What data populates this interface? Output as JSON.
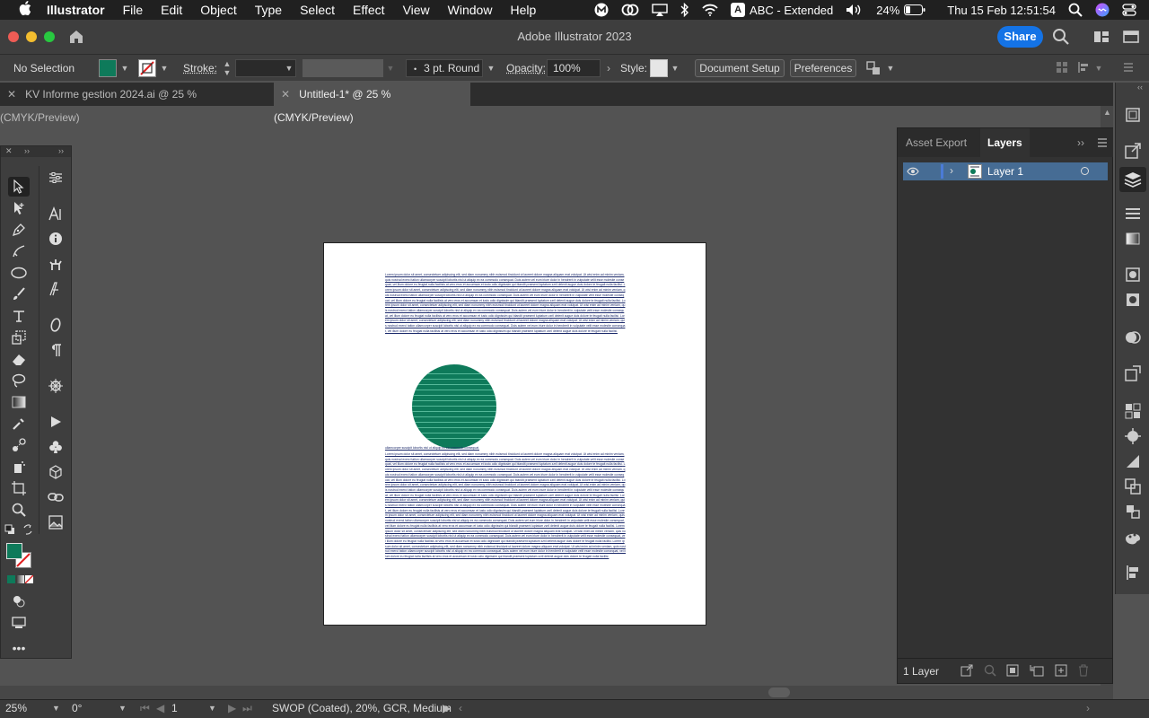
{
  "menubar": {
    "app_name": "Illustrator",
    "items": [
      "File",
      "Edit",
      "Object",
      "Type",
      "Select",
      "Effect",
      "View",
      "Window",
      "Help"
    ],
    "input_source": "ABC - Extended",
    "battery": "24%",
    "datetime": "Thu 15 Feb  12:51:54"
  },
  "window": {
    "title": "Adobe Illustrator 2023",
    "share_label": "Share"
  },
  "control_bar": {
    "selection_label": "No Selection",
    "fill_color": "#0e7a5a",
    "stroke_label": "Stroke:",
    "brush_label": "3 pt. Round",
    "opacity_label": "Opacity:",
    "opacity_value": "100%",
    "style_label": "Style:",
    "document_setup_label": "Document Setup",
    "preferences_label": "Preferences"
  },
  "tabs": [
    {
      "label": "KV Informe gestion 2024.ai @ 25 % (CMYK/Preview)",
      "active": false
    },
    {
      "label": "Untitled-1* @ 25 % (CMYK/Preview)",
      "active": true
    }
  ],
  "artboard": {
    "paragraph_text": "Lorem ipsum dolor sit amet, consectetuer adipiscing elit, sed diam nonummy nibh euismod tincidunt ut laoreet dolore magna aliquam erat volutpat. Ut wisi enim ad minim veniam, quis nostrud exerci tation ullamcorper suscipit lobortis nisl ut aliquip ex ea commodo consequat. Duis autem vel eum iriure dolor in hendrerit in vulputate velit esse molestie consequat, vel illum dolore eu feugiat nulla facilisis at vero eros et accumsan et iusto odio dignissim qui blandit praesent luptatum zzril delenit augue duis dolore te feugait nulla facilisi.",
    "wrap_line": "ullamcorper suscipit lobortis nisl ut aliquip ex ea commodo consequat.",
    "circle_color": "#0e7a5a"
  },
  "layers_panel": {
    "tabs": [
      "Asset Export",
      "Layers"
    ],
    "active_tab": "Layers",
    "layers": [
      {
        "name": "Layer 1",
        "color": "#4b7bd6"
      }
    ],
    "footer_count": "1 Layer"
  },
  "status_bar": {
    "zoom": "25%",
    "rotation": "0°",
    "artboard_number": "1",
    "color_profile": "SWOP (Coated), 20%, GCR, Medium"
  }
}
